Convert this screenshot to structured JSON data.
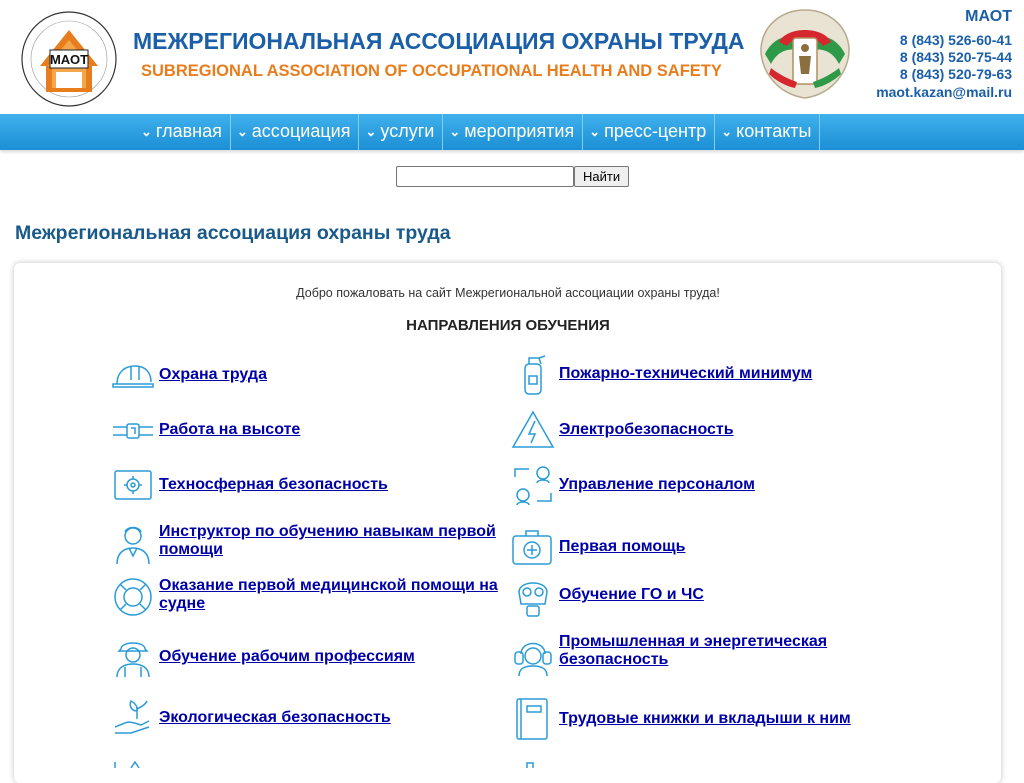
{
  "header": {
    "title": "МЕЖРЕГИОНАЛЬНАЯ АССОЦИАЦИЯ ОХРАНЫ ТРУДА",
    "subtitle": "SUBREGIONAL ASSOCIATION OF OCCUPATIONAL HEALTH AND SAFETY",
    "logo_text": "МАОТ",
    "contacts": {
      "org": "МАОТ",
      "phones": [
        "8 (843) 526-60-41",
        "8 (843) 520-75-44",
        "8 (843) 520-79-63"
      ],
      "email": "maot.kazan@mail.ru"
    }
  },
  "nav": {
    "items": [
      "главная",
      "ассоциация",
      "услуги",
      "мероприятия",
      "пресс-центр",
      "контакты"
    ]
  },
  "search": {
    "value": "",
    "button": "Найти"
  },
  "page": {
    "title": "Межрегиональная ассоциация охраны труда",
    "welcome": "Добро пожаловать на сайт Межрегиональной ассоциации охраны труда!",
    "heading": "НАПРАВЛЕНИЯ ОБУЧЕНИЯ"
  },
  "courses": {
    "left": [
      {
        "label": "Охрана труда",
        "icon": "hard-hat-icon"
      },
      {
        "label": "Работа на высоте",
        "icon": "safety-belt-icon"
      },
      {
        "label": "Техносферная безопасность",
        "icon": "blueprint-gear-icon"
      },
      {
        "label": "Инструктор по обучению навыкам первой помощи",
        "icon": "doctor-icon"
      },
      {
        "label": "Оказание первой медицинской помощи на судне",
        "icon": "lifebuoy-icon"
      },
      {
        "label": "Обучение рабочим профессиям",
        "icon": "worker-icon"
      },
      {
        "label": "Экологическая безопасность",
        "icon": "hand-plant-icon"
      }
    ],
    "right": [
      {
        "label": "Пожарно-технический минимум",
        "icon": "fire-extinguisher-icon"
      },
      {
        "label": "Электробезопасность",
        "icon": "high-voltage-icon"
      },
      {
        "label": "Управление персоналом",
        "icon": "personnel-exchange-icon"
      },
      {
        "label": "Первая помощь",
        "icon": "first-aid-kit-icon"
      },
      {
        "label": "Обучение ГО и ЧС",
        "icon": "gas-mask-icon"
      },
      {
        "label": "Промышленная и энергетическая безопасность",
        "icon": "ear-protection-icon"
      },
      {
        "label": "Трудовые книжки и вкладыши к ним",
        "icon": "work-book-icon"
      }
    ]
  },
  "colors": {
    "brand_blue": "#1a5fa8",
    "brand_orange": "#e87d1e",
    "nav_blue": "#1c8fd6",
    "link": "#0000a8",
    "icon_blue": "#2a9bd7"
  }
}
